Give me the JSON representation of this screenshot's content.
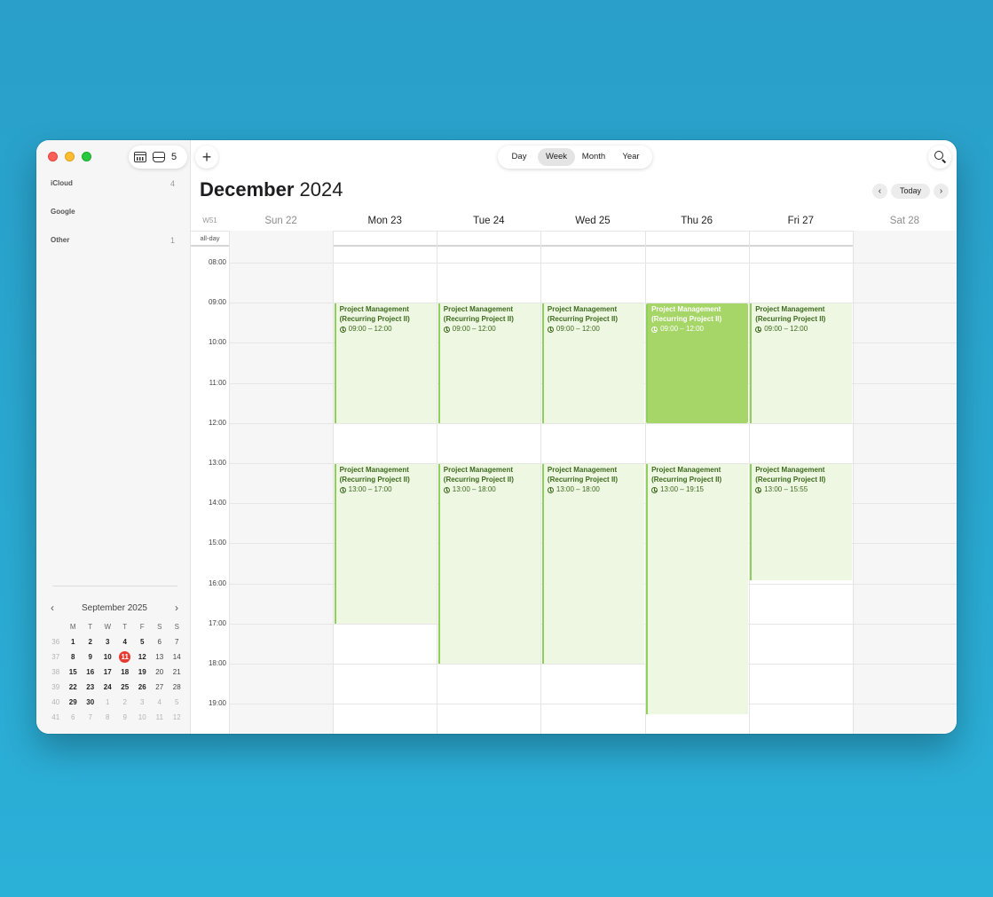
{
  "toolbar": {
    "inbox_count": "5",
    "add_label": "+",
    "views": [
      "Day",
      "Week",
      "Month",
      "Year"
    ],
    "active_view": "Week"
  },
  "sidebar": {
    "sources": [
      {
        "name": "iCloud",
        "count": "4"
      },
      {
        "name": "Google",
        "count": ""
      },
      {
        "name": "Other",
        "count": "1"
      }
    ]
  },
  "mini_calendar": {
    "title": "September 2025",
    "prev": "‹",
    "next": "›",
    "weekdays": [
      "M",
      "T",
      "W",
      "T",
      "F",
      "S",
      "S"
    ],
    "weeks": [
      {
        "wk": "36",
        "days": [
          "1",
          "2",
          "3",
          "4",
          "5",
          "6",
          "7"
        ]
      },
      {
        "wk": "37",
        "days": [
          "8",
          "9",
          "10",
          "11",
          "12",
          "13",
          "14"
        ]
      },
      {
        "wk": "38",
        "days": [
          "15",
          "16",
          "17",
          "18",
          "19",
          "20",
          "21"
        ]
      },
      {
        "wk": "39",
        "days": [
          "22",
          "23",
          "24",
          "25",
          "26",
          "27",
          "28"
        ]
      },
      {
        "wk": "40",
        "days": [
          "29",
          "30",
          "1",
          "2",
          "3",
          "4",
          "5"
        ]
      },
      {
        "wk": "41",
        "days": [
          "6",
          "7",
          "8",
          "9",
          "10",
          "11",
          "12"
        ]
      }
    ],
    "today": "11"
  },
  "header": {
    "month": "December",
    "year": "2024",
    "today_label": "Today",
    "prev": "‹",
    "next": "›"
  },
  "week": {
    "label": "W51",
    "allday_label": "all-day",
    "days": [
      "Sun 22",
      "Mon 23",
      "Tue 24",
      "Wed 25",
      "Thu 26",
      "Fri 27",
      "Sat 28"
    ],
    "hours": [
      "08:00",
      "09:00",
      "10:00",
      "11:00",
      "12:00",
      "13:00",
      "14:00",
      "15:00",
      "16:00",
      "17:00",
      "18:00",
      "19:00"
    ]
  },
  "events": [
    {
      "day": 1,
      "start": 9,
      "end": 12,
      "title": "Project Management (Recurring Project II)",
      "time": "09:00 – 12:00"
    },
    {
      "day": 2,
      "start": 9,
      "end": 12,
      "title": "Project Management (Recurring Project II)",
      "time": "09:00 – 12:00"
    },
    {
      "day": 3,
      "start": 9,
      "end": 12,
      "title": "Project Management (Recurring Project II)",
      "time": "09:00 – 12:00"
    },
    {
      "day": 4,
      "start": 9,
      "end": 12,
      "title": "Project Management (Recurring Project II)",
      "time": "09:00 – 12:00",
      "selected": true
    },
    {
      "day": 5,
      "start": 9,
      "end": 12,
      "title": "Project Management (Recurring Project II)",
      "time": "09:00 – 12:00"
    },
    {
      "day": 1,
      "start": 13,
      "end": 17,
      "title": "Project Management (Recurring Project II)",
      "time": "13:00 – 17:00"
    },
    {
      "day": 2,
      "start": 13,
      "end": 18,
      "title": "Project Management (Recurring Project II)",
      "time": "13:00 – 18:00"
    },
    {
      "day": 3,
      "start": 13,
      "end": 18,
      "title": "Project Management (Recurring Project II)",
      "time": "13:00 – 18:00"
    },
    {
      "day": 4,
      "start": 13,
      "end": 19.25,
      "title": "Project Management (Recurring Project II)",
      "time": "13:00 – 19:15"
    },
    {
      "day": 5,
      "start": 13,
      "end": 15.9167,
      "title": "Project Management (Recurring Project II)",
      "time": "13:00 – 15:55"
    }
  ],
  "colors": {
    "event_bg": "#eef7e2",
    "event_accent": "#8fd05a",
    "event_selected": "#a6d568",
    "today_red": "#e63b30"
  }
}
